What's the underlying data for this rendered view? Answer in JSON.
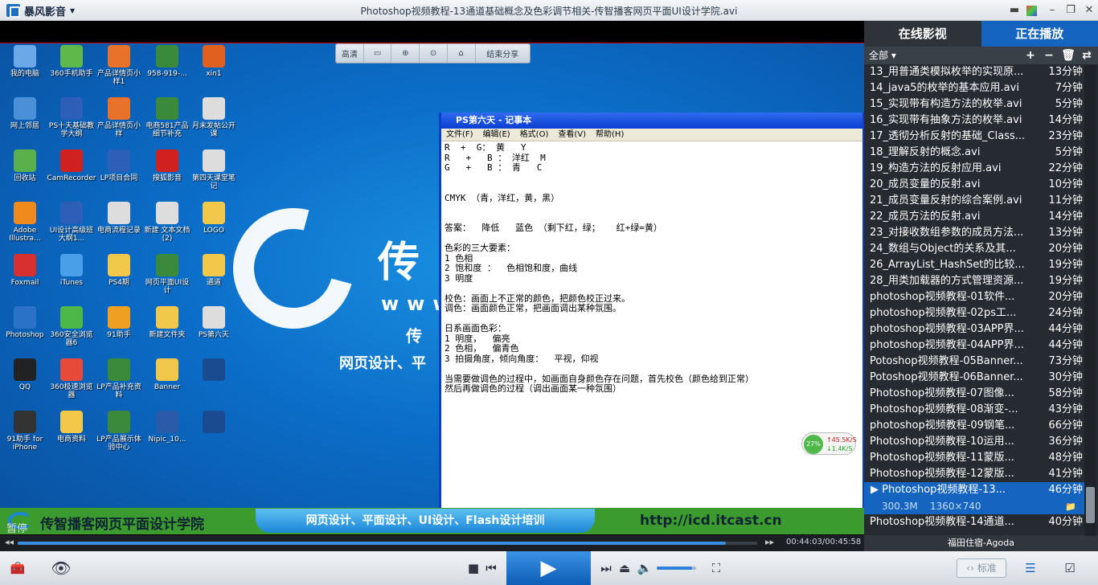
{
  "app": {
    "name": "暴风影音",
    "title": "Photoshop视频教程-13通道基础概念及色彩调节相关-传智播客网页平面UI设计学院.avi"
  },
  "video_toolbar": {
    "items": [
      "高清",
      "",
      "",
      "",
      "",
      "结束分享"
    ]
  },
  "desktop_icons": [
    {
      "label": "我的电脑",
      "color": "#6aa8e8"
    },
    {
      "label": "360手机助手",
      "color": "#5fb84a"
    },
    {
      "label": "产品详情页小样1",
      "color": "#e8722a"
    },
    {
      "label": "958-919-...",
      "color": "#3b8a3b"
    },
    {
      "label": "xin1",
      "color": "#e06020"
    },
    {
      "label": "网上邻居",
      "color": "#4a90d8"
    },
    {
      "label": "PS十天基础教学大纲",
      "color": "#2d5fb8"
    },
    {
      "label": "产品详情页小样",
      "color": "#e8722a"
    },
    {
      "label": "电商581产品细节补充",
      "color": "#3b8a3b"
    },
    {
      "label": "月末发帖公开课",
      "color": "#dddddd"
    },
    {
      "label": "回收站",
      "color": "#5ab04a"
    },
    {
      "label": "CamRecorder",
      "color": "#d02020"
    },
    {
      "label": "LP项目合同",
      "color": "#2d5fb8"
    },
    {
      "label": "搜狐影音",
      "color": "#d02020"
    },
    {
      "label": "第四天课堂笔记",
      "color": "#dddddd"
    },
    {
      "label": "Adobe Illustra...",
      "color": "#f08a1c"
    },
    {
      "label": "UI设计高级班大纲1...",
      "color": "#2d5fb8"
    },
    {
      "label": "电商流程记录",
      "color": "#dddddd"
    },
    {
      "label": "新建 文本文档 (2)",
      "color": "#dddddd"
    },
    {
      "label": "LOGO",
      "color": "#f1c84a"
    },
    {
      "label": "Foxmail",
      "color": "#d83030"
    },
    {
      "label": "iTunes",
      "color": "#4aa0e8"
    },
    {
      "label": "PS4期",
      "color": "#f1c84a"
    },
    {
      "label": "网页平面UI设计",
      "color": "#3b8a3b"
    },
    {
      "label": "通道",
      "color": "#f1c84a"
    },
    {
      "label": "Photoshop",
      "color": "#2a72c8"
    },
    {
      "label": "360安全浏览器6",
      "color": "#4cb848"
    },
    {
      "label": "91助手",
      "color": "#f0a020"
    },
    {
      "label": "新建文件夹",
      "color": "#f1c84a"
    },
    {
      "label": "PS第六天",
      "color": "#dddddd"
    },
    {
      "label": "QQ",
      "color": "#222222"
    },
    {
      "label": "360极速浏览器",
      "color": "#e84a3a"
    },
    {
      "label": "LP产品补充资料",
      "color": "#3b8a3b"
    },
    {
      "label": "Banner",
      "color": "#f1c84a"
    },
    {
      "label": "",
      "color": "#1a4a90"
    },
    {
      "label": "91助手 for iPhone",
      "color": "#333333"
    },
    {
      "label": "电商资料",
      "color": "#f1c84a"
    },
    {
      "label": "LP产品展示体验中心",
      "color": "#3b8a3b"
    },
    {
      "label": "Nipic_10...",
      "color": "#2a5aa8"
    },
    {
      "label": "",
      "color": "#1a4a90"
    }
  ],
  "watermark": {
    "char": "传",
    "url_text": "www",
    "line1": "传",
    "line2": "网页设计、平"
  },
  "notepad": {
    "title": "PS第六天 - 记事本",
    "menu": [
      "文件(F)",
      "编辑(E)",
      "格式(O)",
      "查看(V)",
      "帮助(H)"
    ],
    "lines": [
      "R  +  G： 黄   Y",
      "R   +   B ： 洋红  M",
      "G   +   B ： 青   C",
      "",
      "",
      "CMYK （青，洋红，黄，黑）",
      "",
      "",
      "答案：  降低   蓝色 （剩下红，绿；   红+绿=黄）",
      "",
      "色彩的三大要素：",
      "1 色相",
      "2 饱和度 ：  色相饱和度，曲线",
      "3 明度",
      "",
      "校色：画面上不正常的颜色，把颜色校正过来。",
      "调色：画面颜色正常，把画面调出某种氛围。",
      "",
      "日系画面色彩：",
      "1 明度，  偏亮",
      "2 色相，  偏青色",
      "3 拍摄角度，倾向角度：  平视，仰视",
      "",
      "当需要做调色的过程中，如画面自身颜色存在问题，首先校色（颜色给到正常）",
      "然后再做调色的过程（调出画面某一种氛围）"
    ]
  },
  "speed_widget": {
    "percent": "27%",
    "up": "45.5K/S",
    "down": "1.4K/S"
  },
  "banner": {
    "left": "传智播客网页平面设计学院",
    "middle": "网页设计、平面设计、UI设计、Flash设计培训",
    "right": "http://icd.itcast.cn"
  },
  "status": {
    "text": "暂停"
  },
  "progress": {
    "time": "00:44:03/00:45:58",
    "fraction": 0.958
  },
  "volume": {
    "fraction": 0.9
  },
  "bottom": {
    "quality_label": "标准"
  },
  "panel": {
    "tabs": [
      "在线影视",
      "正在播放"
    ],
    "filter": "全部",
    "footer": "福田住宿-Agoda",
    "playlist": [
      {
        "name": "13_用普通类模拟枚举的实现原...",
        "dur": "13分钟"
      },
      {
        "name": "14_java5的枚举的基本应用.avi",
        "dur": "7分钟"
      },
      {
        "name": "15_实现带有构造方法的枚举.avi",
        "dur": "5分钟"
      },
      {
        "name": "16_实现带有抽象方法的枚举.avi",
        "dur": "14分钟"
      },
      {
        "name": "17_透彻分析反射的基础_Class...",
        "dur": "23分钟"
      },
      {
        "name": "18_理解反射的概念.avi",
        "dur": "5分钟"
      },
      {
        "name": "19_构造方法的反射应用.avi",
        "dur": "22分钟"
      },
      {
        "name": "20_成员变量的反射.avi",
        "dur": "10分钟"
      },
      {
        "name": "21_成员变量反射的综合案例.avi",
        "dur": "11分钟"
      },
      {
        "name": "22_成员方法的反射.avi",
        "dur": "14分钟"
      },
      {
        "name": "23_对接收数组参数的成员方法...",
        "dur": "13分钟"
      },
      {
        "name": "24_数组与Object的关系及其...",
        "dur": "20分钟"
      },
      {
        "name": "26_ArrayList_HashSet的比较...",
        "dur": "19分钟"
      },
      {
        "name": "28_用类加载器的方式管理资源...",
        "dur": "19分钟"
      },
      {
        "name": "photoshop视频教程-01软件...",
        "dur": "20分钟"
      },
      {
        "name": "photoshop视频教程-02ps工...",
        "dur": "24分钟"
      },
      {
        "name": "photoshop视频教程-03APP界...",
        "dur": "44分钟"
      },
      {
        "name": "photoshop视频教程-04APP界...",
        "dur": "44分钟"
      },
      {
        "name": "Potoshop视频教程-05Banner...",
        "dur": "73分钟"
      },
      {
        "name": "Potoshop视频教程-06Banner...",
        "dur": "30分钟"
      },
      {
        "name": "Photoshop视频教程-07图像...",
        "dur": "58分钟"
      },
      {
        "name": "Photoshop视频教程-08渐变-...",
        "dur": "43分钟"
      },
      {
        "name": "photoshop视频教程-09钢笔...",
        "dur": "66分钟"
      },
      {
        "name": "Photoshop视频教程-10运用...",
        "dur": "36分钟"
      },
      {
        "name": "Photoshop视频教程-11蒙版...",
        "dur": "48分钟"
      },
      {
        "name": "Photoshop视频教程-12蒙版...",
        "dur": "41分钟"
      }
    ],
    "active": {
      "name": "Photoshop视频教程-13...",
      "dur": "46分钟",
      "size": "300.3M",
      "res": "1360×740"
    },
    "after": [
      {
        "name": "Photoshop视频教程-14通道...",
        "dur": "40分钟"
      }
    ]
  }
}
